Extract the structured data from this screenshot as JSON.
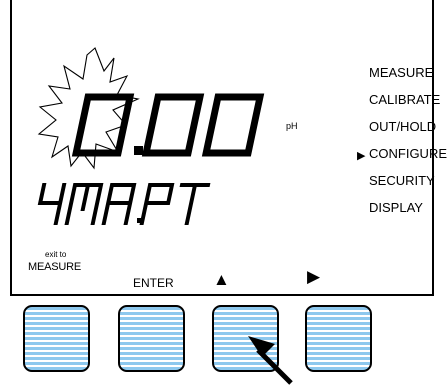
{
  "display": {
    "value": "0.00",
    "unit": "pH",
    "status_text": "4MA.PT",
    "value_state": "flashing"
  },
  "menu": {
    "items": [
      {
        "label": "MEASURE",
        "selected": false
      },
      {
        "label": "CALIBRATE",
        "selected": false
      },
      {
        "label": "OUT/HOLD",
        "selected": false
      },
      {
        "label": "CONFIGURE",
        "selected": true
      },
      {
        "label": "SECURITY",
        "selected": false
      },
      {
        "label": "DISPLAY",
        "selected": false
      }
    ],
    "pointer_glyph": "▶"
  },
  "softkey_labels": {
    "exit_small": "exit to",
    "exit_main": "MEASURE",
    "enter": "ENTER",
    "up_glyph": "▲",
    "right_glyph": "▶"
  },
  "keys": [
    {
      "name": "softkey-1"
    },
    {
      "name": "softkey-2"
    },
    {
      "name": "softkey-3",
      "pointed": true
    },
    {
      "name": "softkey-4"
    }
  ],
  "colors": {
    "key_stripe": "#8dc8ee",
    "ink": "#000000"
  }
}
